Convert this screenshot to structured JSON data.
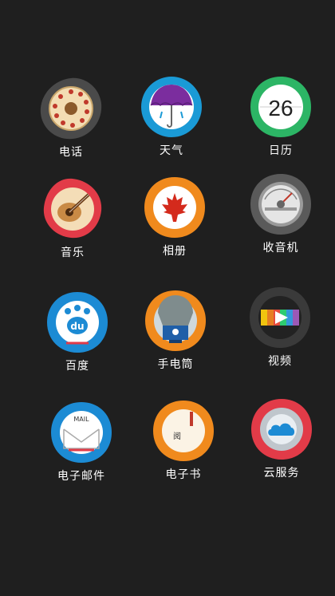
{
  "apps": [
    {
      "label": "电话"
    },
    {
      "label": "天气"
    },
    {
      "label": "日历",
      "date": "26"
    },
    {
      "label": "音乐"
    },
    {
      "label": "相册"
    },
    {
      "label": "收音机"
    },
    {
      "label": "百度",
      "logo_text": "du"
    },
    {
      "label": "手电筒"
    },
    {
      "label": "视频"
    },
    {
      "label": "电子邮件",
      "logo_text": "MAIL"
    },
    {
      "label": "电子书",
      "logo_text": "阅"
    },
    {
      "label": "云服务"
    }
  ]
}
